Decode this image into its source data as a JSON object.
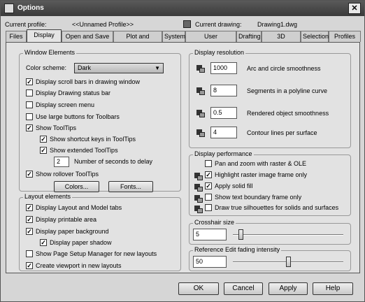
{
  "window": {
    "title": "Options"
  },
  "profile": {
    "label": "Current profile:",
    "value": "<<Unnamed Profile>>"
  },
  "drawing": {
    "label": "Current drawing:",
    "value": "Drawing1.dwg"
  },
  "tabs": [
    "Files",
    "Display",
    "Open and Save",
    "Plot and Publish",
    "System",
    "User Preferences",
    "Drafting",
    "3D Modeling",
    "Selection",
    "Profiles"
  ],
  "active_tab": "Display",
  "window_elements": {
    "legend": "Window Elements",
    "color_scheme_label": "Color scheme:",
    "color_scheme_value": "Dark",
    "options": [
      {
        "label": "Display scroll bars in drawing window",
        "checked": true
      },
      {
        "label": "Display Drawing status bar",
        "checked": false
      },
      {
        "label": "Display screen menu",
        "checked": false
      },
      {
        "label": "Use large buttons for Toolbars",
        "checked": false
      },
      {
        "label": "Show ToolTips",
        "checked": true
      },
      {
        "label": "Show shortcut keys in ToolTips",
        "checked": true
      },
      {
        "label": "Show extended ToolTips",
        "checked": true
      }
    ],
    "seconds_value": "2",
    "seconds_label": "Number of seconds to delay",
    "rollover": {
      "label": "Show rollover ToolTips",
      "checked": true
    },
    "colors_button": "Colors...",
    "fonts_button": "Fonts..."
  },
  "layout_elements": {
    "legend": "Layout elements",
    "options": [
      {
        "label": "Display Layout and Model tabs",
        "checked": true
      },
      {
        "label": "Display printable area",
        "checked": true
      },
      {
        "label": "Display paper background",
        "checked": true
      },
      {
        "label": "Display paper shadow",
        "checked": true
      },
      {
        "label": "Show Page Setup Manager for new layouts",
        "checked": false
      },
      {
        "label": "Create viewport in new layouts",
        "checked": true
      }
    ]
  },
  "display_resolution": {
    "legend": "Display resolution",
    "rows": [
      {
        "value": "1000",
        "label": "Arc and circle smoothness"
      },
      {
        "value": "8",
        "label": "Segments in a polyline curve"
      },
      {
        "value": "0.5",
        "label": "Rendered object smoothness"
      },
      {
        "value": "4",
        "label": "Contour lines per surface"
      }
    ]
  },
  "display_performance": {
    "legend": "Display performance",
    "options": [
      {
        "label": "Pan and zoom with raster & OLE",
        "checked": false
      },
      {
        "label": "Highlight raster image frame only",
        "checked": true
      },
      {
        "label": "Apply solid fill",
        "checked": true
      },
      {
        "label": "Show text boundary frame only",
        "checked": false
      },
      {
        "label": "Draw true silhouettes for solids and surfaces",
        "checked": false
      }
    ]
  },
  "crosshair": {
    "legend": "Crosshair size",
    "value": "5",
    "level": 0.05
  },
  "xref_fade": {
    "legend": "Reference Edit fading intensity",
    "value": "50",
    "level": 0.5
  },
  "footer": {
    "ok": "OK",
    "cancel": "Cancel",
    "apply": "Apply",
    "help": "Help"
  }
}
